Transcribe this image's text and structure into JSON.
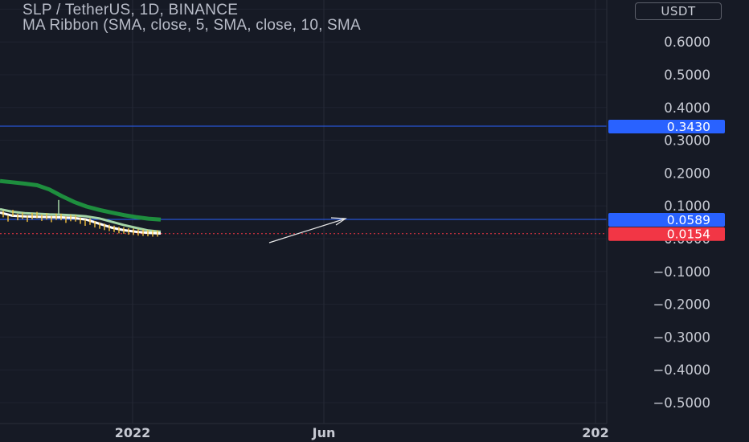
{
  "header": {
    "title": "SLP / TetherUS, 1D, BINANCE",
    "indicator": "MA Ribbon (SMA, close, 5, SMA, close, 10, SMA"
  },
  "currency": "USDT",
  "colors": {
    "background": "#161a25",
    "price_line": "#2962ff",
    "tag_blue": "#2962ff",
    "tag_red": "#f23645",
    "ma_long": "#1e8e3e",
    "ma_mid": "#a5d6a7",
    "ma_fast": "#ffffff",
    "candles": "#f6c23e",
    "current_price_line": "#f23645"
  },
  "chart_data": {
    "type": "line",
    "ylim": [
      -0.55,
      0.72
    ],
    "y_ticks": [
      "0.6000",
      "0.5000",
      "0.4000",
      "0.3000",
      "0.2000",
      "0.1000",
      "0.0000",
      "−0.1000",
      "−0.2000",
      "−0.3000",
      "−0.4000",
      "−0.5000"
    ],
    "y_tick_values": [
      0.6,
      0.5,
      0.4,
      0.3,
      0.2,
      0.1,
      0.0,
      -0.1,
      -0.2,
      -0.3,
      -0.4,
      -0.5
    ],
    "x_ticks": [
      "2022",
      "Jun",
      "202"
    ],
    "price_levels": [
      {
        "label": "0.3430",
        "value": 0.343,
        "color": "#2962ff"
      },
      {
        "label": "0.0589",
        "value": 0.0589,
        "color": "#2962ff"
      },
      {
        "label": "0.0154",
        "value": 0.0154,
        "color": "#f23645"
      }
    ],
    "series": [
      {
        "color": "#1e8e3e",
        "values": [
          0.176,
          0.172,
          0.168,
          0.163,
          0.15,
          0.13,
          0.112,
          0.098,
          0.088,
          0.08,
          0.072,
          0.066,
          0.061,
          0.058
        ]
      },
      {
        "color": "#a5d6a7",
        "values": [
          0.09,
          0.082,
          0.078,
          0.076,
          0.074,
          0.073,
          0.071,
          0.068,
          0.062,
          0.052,
          0.042,
          0.033,
          0.025,
          0.021
        ]
      },
      {
        "color": "#ffffff",
        "values": [
          0.08,
          0.07,
          0.068,
          0.067,
          0.066,
          0.065,
          0.063,
          0.058,
          0.046,
          0.034,
          0.026,
          0.021,
          0.018,
          0.016
        ]
      }
    ],
    "candles": [
      0.075,
      0.062,
      0.078,
      0.066,
      0.07,
      0.061,
      0.069,
      0.072,
      0.064,
      0.068,
      0.06,
      0.067,
      0.066,
      0.058,
      0.063,
      0.062,
      0.055,
      0.049,
      0.052,
      0.044,
      0.04,
      0.036,
      0.033,
      0.03,
      0.026,
      0.025,
      0.022,
      0.021,
      0.019,
      0.018,
      0.017,
      0.016,
      0.016
    ],
    "spike": {
      "value": 0.118
    }
  }
}
